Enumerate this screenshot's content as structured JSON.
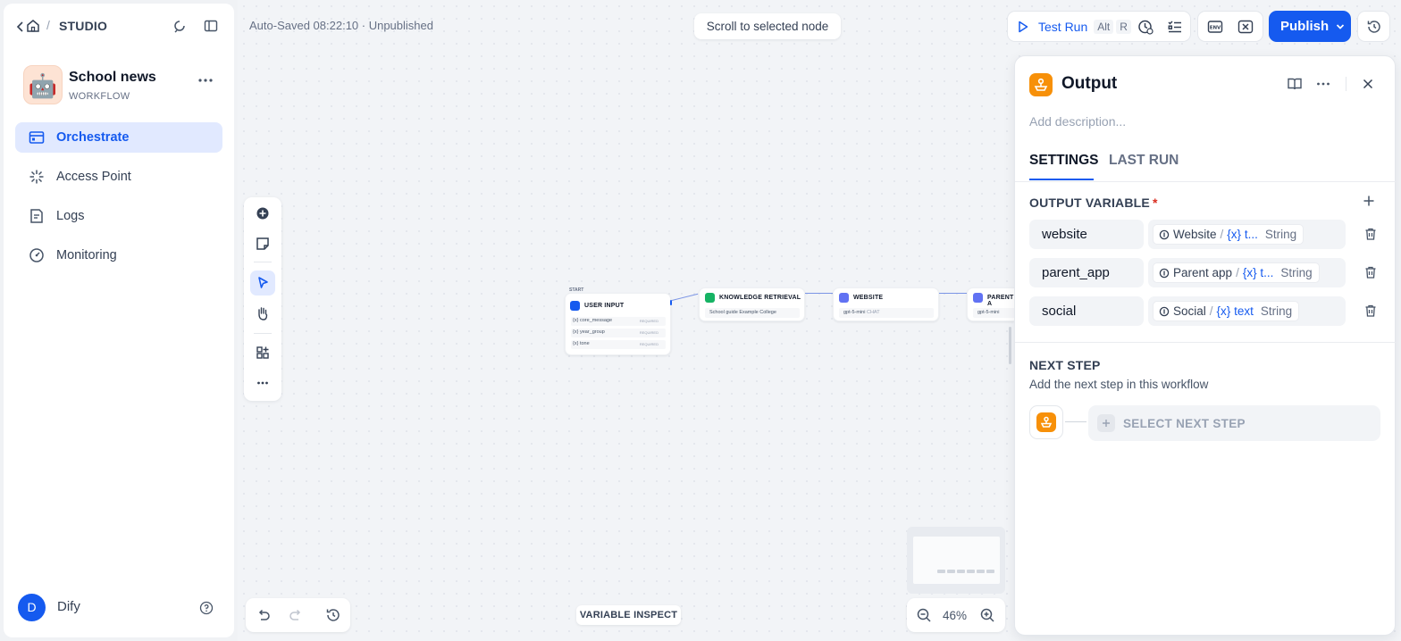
{
  "header": {
    "breadcrumb_root": "STUDIO",
    "autosave_status": "Auto-Saved 08:22:10 · Unpublished",
    "scroll_to_node": "Scroll to selected node",
    "test_run": {
      "label": "Test Run",
      "shortcut_1": "Alt",
      "shortcut_2": "R"
    },
    "publish": "Publish"
  },
  "app": {
    "name": "School news",
    "type": "WORKFLOW",
    "avatar": "🤖"
  },
  "sidebar": {
    "items": [
      {
        "label": "Orchestrate",
        "icon": "orchestrate-icon",
        "active": true
      },
      {
        "label": "Access Point",
        "icon": "access-point-icon",
        "active": false
      },
      {
        "label": "Logs",
        "icon": "logs-icon",
        "active": false
      },
      {
        "label": "Monitoring",
        "icon": "monitoring-icon",
        "active": false
      }
    ]
  },
  "user": {
    "initial": "D",
    "name": "Dify"
  },
  "canvas": {
    "start_tag": "START",
    "nodes": {
      "user_input": {
        "title": "USER INPUT",
        "variables": [
          {
            "name": "{x} core_message",
            "req": "REQUIRED"
          },
          {
            "name": "{x} year_group",
            "req": "REQUIRED"
          },
          {
            "name": "{x} tone",
            "req": "REQUIRED"
          }
        ]
      },
      "knowledge": {
        "title": "KNOWLEDGE RETRIEVAL",
        "sub": "School guide Example College"
      },
      "website": {
        "title": "WEBSITE",
        "sub": "gpt-5-mini",
        "tag": "CHAT"
      },
      "parent": {
        "title": "PARENT A",
        "sub": "gpt-5-mini"
      }
    },
    "variable_inspect": "VARIABLE INSPECT",
    "zoom": "46%"
  },
  "panel": {
    "title": "Output",
    "description_placeholder": "Add description...",
    "tabs": [
      "SETTINGS",
      "LAST RUN"
    ],
    "output_variable_label": "OUTPUT VARIABLE",
    "required_mark": "*",
    "outputs": [
      {
        "name": "website",
        "node": "Website",
        "var": "{x} t...",
        "type": "String"
      },
      {
        "name": "parent_app",
        "node": "Parent app",
        "var": "{x} t...",
        "type": "String"
      },
      {
        "name": "social",
        "node": "Social",
        "var": "{x} text",
        "type": "String"
      }
    ],
    "next_step": {
      "title": "NEXT STEP",
      "description": "Add the next step in this workflow",
      "button": "SELECT NEXT STEP"
    }
  },
  "colors": {
    "accent": "#155aef",
    "output_node": "#f79009",
    "knowledge_node": "#16b364",
    "llm_node": "#6172f3"
  }
}
